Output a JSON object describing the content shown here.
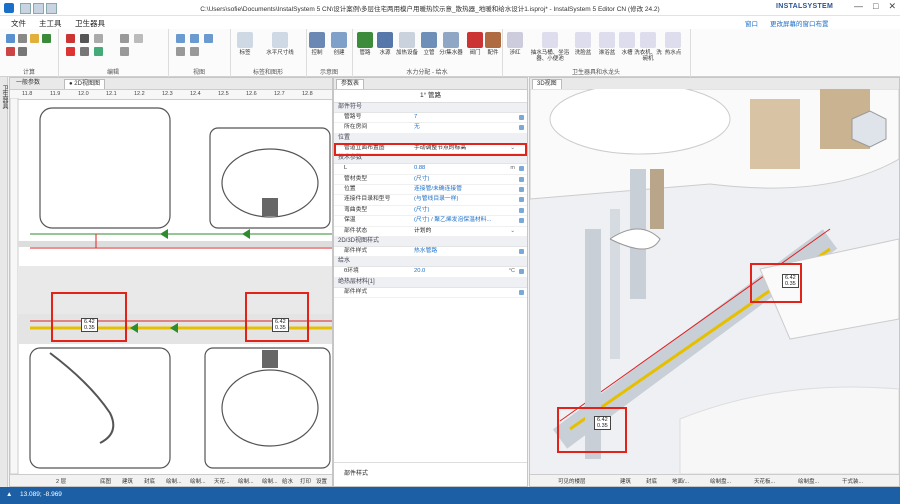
{
  "window": {
    "title": "C:\\Users\\sofie\\Documents\\InstalSystem 5 CN\\设计案例\\多层住宅两用模户用暖热饮示意_散热器_地暖和给水设计1.isproj* - InstalSystem 5 Editor CN (修改 24.2)",
    "brand": "INSTALSYSTEM",
    "controls": [
      "—",
      "□",
      "✕"
    ]
  },
  "menu": {
    "items": [
      "文件",
      "主工具",
      "卫生器具"
    ],
    "active": "主工具",
    "right_items": [
      "窗口",
      "更改屏幕的窗口布置"
    ]
  },
  "ribbon": {
    "groups": [
      {
        "label": "计算"
      },
      {
        "label": "编辑"
      },
      {
        "label": "视图"
      },
      {
        "label": "标签和图形",
        "buttons": [
          "标签",
          "水平尺寸线"
        ]
      },
      {
        "label": "示意图",
        "buttons": [
          "控制",
          "创建"
        ]
      },
      {
        "label": "水力分配 - 给水",
        "buttons": [
          "管路",
          "水源",
          "加热设备",
          "立管",
          "分/集水器",
          "阀门",
          "配件"
        ]
      },
      {
        "label": "卫生器具和水龙头",
        "buttons": [
          "涉红",
          "抽水马桶、坐浴器、小便池",
          "洗脸盆",
          "淋浴盆",
          "水槽",
          "洗衣机、洗碗机",
          "热水点"
        ]
      }
    ]
  },
  "left_strip": "卫生器具",
  "plan_panel": {
    "tabs": [
      "一般参数",
      "● 2D视图图"
    ],
    "ruler": [
      "11.8",
      "11.9",
      "12.0",
      "12.1",
      "12.2",
      "12.3",
      "12.4",
      "12.5",
      "12.6",
      "12.7",
      "12.8"
    ],
    "tags": [
      {
        "a": "6.42",
        "b": "0.35"
      },
      {
        "a": "6.42",
        "b": "0.35"
      }
    ],
    "bottom": [
      "2 层",
      "底图",
      "建筑",
      "封底",
      "绘制...",
      "绘制...",
      "天花...",
      "绘制...",
      "绘制...",
      "给水",
      "打印",
      "设置"
    ]
  },
  "properties_panel": {
    "tab": "参数表",
    "title": "1° 管路",
    "sections": [
      {
        "name": "部件符号",
        "rows": [
          {
            "k": "管路号",
            "v": "7"
          },
          {
            "k": "所在房间",
            "v": "无"
          }
        ]
      },
      {
        "name": "位置",
        "rows": [
          {
            "k": "管道立面布置图",
            "v": "手动调整节点的标高",
            "highlight": true
          }
        ]
      },
      {
        "name": "技术参数",
        "rows": [
          {
            "k": "L",
            "v": "0.88",
            "u": "m"
          },
          {
            "k": "管材类型",
            "v": "(尺寸)"
          },
          {
            "k": "位置",
            "v": "连接管/未确连接管"
          },
          {
            "k": "连接件目录和型号",
            "v": "(与管线目录一样)"
          },
          {
            "k": "弯曲类型",
            "v": "(尺寸)"
          },
          {
            "k": "保温",
            "v": "(尺寸) / 聚乙烯发泡保温材料..."
          },
          {
            "k": "部件状态",
            "v": "计划的"
          }
        ]
      },
      {
        "name": "2D/3D视图样式",
        "rows": [
          {
            "k": "部件样式",
            "v": "热水管路"
          }
        ]
      },
      {
        "name": "给水",
        "rows": [
          {
            "k": "θ环境",
            "v": "20.0",
            "u": "°C"
          }
        ]
      },
      {
        "name": "绝热层材料[1]",
        "rows": [
          {
            "k": "部件样式",
            "v": ""
          }
        ]
      }
    ],
    "footer": "部件样式"
  },
  "view3d": {
    "tab": "3D视图",
    "tag": {
      "a": "6.42",
      "b": "0.35"
    },
    "bottom": [
      "可见的楼层",
      "建筑",
      "封底",
      "地面/...",
      "绘制盘...",
      "天花板...",
      "绘制盘...",
      "干式装..."
    ]
  },
  "status": {
    "coords": "13.089; -8.969"
  }
}
